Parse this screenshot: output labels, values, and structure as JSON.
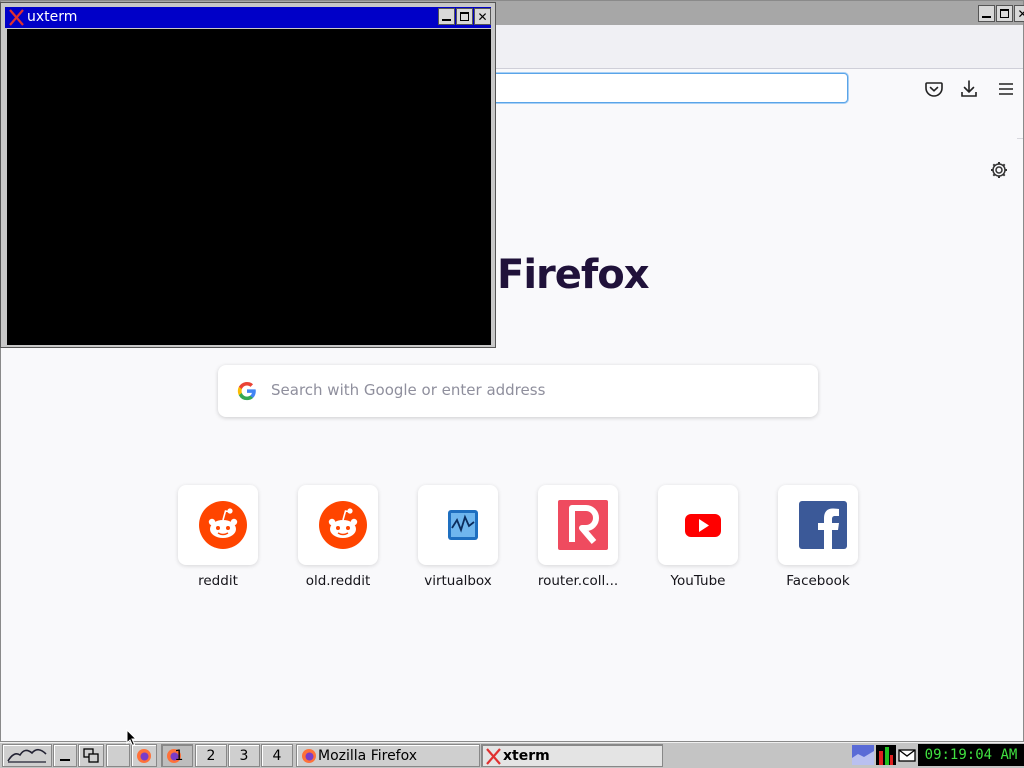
{
  "firefox": {
    "brand_text": "Firefox",
    "search_placeholder": "Search with Google or enter address",
    "top_sites": [
      {
        "label": "reddit",
        "icon": "reddit-icon"
      },
      {
        "label": "old.reddit",
        "icon": "reddit-icon"
      },
      {
        "label": "virtualbox",
        "icon": "virtualbox-icon"
      },
      {
        "label": "router.coll...",
        "icon": "router-r-icon"
      },
      {
        "label": "YouTube",
        "icon": "youtube-icon"
      },
      {
        "label": "Facebook",
        "icon": "facebook-icon"
      }
    ],
    "colors": {
      "reddit": "#ff4500",
      "youtube": "#ff0000",
      "facebook": "#3b5998",
      "router": "#ef4b5f",
      "url_focus": "#5aa4e8"
    }
  },
  "xterm": {
    "title": "uxterm"
  },
  "taskbar": {
    "pager": [
      "1",
      "2",
      "3",
      "4"
    ],
    "tasks": [
      {
        "label": "Mozilla Firefox",
        "icon": "firefox-icon"
      },
      {
        "label": "xterm",
        "icon": "x-icon"
      }
    ],
    "clock": "09:19:04 AM"
  }
}
